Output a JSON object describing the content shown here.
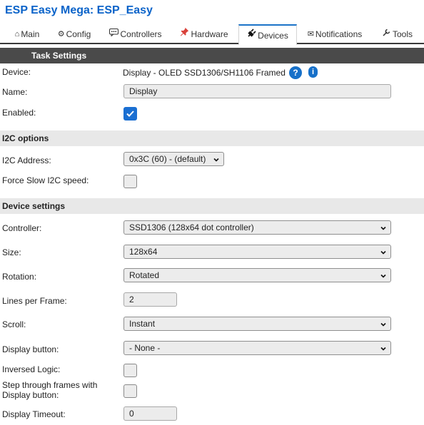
{
  "app": {
    "title": "ESP Easy Mega: ESP_Easy"
  },
  "tabs": [
    {
      "label": "Main",
      "icon": "home-icon",
      "glyph": "⌂"
    },
    {
      "label": "Config",
      "icon": "gear-icon",
      "glyph": "⚙"
    },
    {
      "label": "Controllers",
      "icon": "chat-icon",
      "glyph": "💬"
    },
    {
      "label": "Hardware",
      "icon": "pin-icon",
      "glyph": "📌"
    },
    {
      "label": "Devices",
      "icon": "plug-icon",
      "glyph": "✎",
      "active": true
    },
    {
      "label": "Notifications",
      "icon": "mail-icon",
      "glyph": "✉"
    },
    {
      "label": "Tools",
      "icon": "wrench-icon",
      "glyph": "🔧"
    }
  ],
  "header": {
    "title": "Task Settings"
  },
  "device": {
    "label": "Device:",
    "value": "Display - OLED SSD1306/SH1106 Framed",
    "help_glyph": "?",
    "info_glyph": "i"
  },
  "name": {
    "label": "Name:",
    "value": "Display"
  },
  "enabled": {
    "label": "Enabled:",
    "checked": true
  },
  "i2c_section": {
    "title": "I2C options"
  },
  "i2c_address": {
    "label": "I2C Address:",
    "value": "0x3C (60) - (default)"
  },
  "slow_i2c": {
    "label": "Force Slow I2C speed:",
    "checked": false
  },
  "device_section": {
    "title": "Device settings"
  },
  "controller": {
    "label": "Controller:",
    "value": "SSD1306 (128x64 dot controller)"
  },
  "size": {
    "label": "Size:",
    "value": "128x64"
  },
  "rotation": {
    "label": "Rotation:",
    "value": "Rotated"
  },
  "lines_per_frame": {
    "label": "Lines per Frame:",
    "value": "2"
  },
  "scroll": {
    "label": "Scroll:",
    "value": "Instant"
  },
  "display_button": {
    "label": "Display button:",
    "value": "- None -"
  },
  "inversed_logic": {
    "label": "Inversed Logic:",
    "checked": false
  },
  "step_frames": {
    "label_line1": "Step through frames with",
    "label_line2": "Display button:",
    "checked": false
  },
  "display_timeout": {
    "label": "Display Timeout:",
    "value": "0"
  },
  "colors": {
    "accent": "#1670c9",
    "title": "#0a63c9",
    "header_bg": "#4a4a4a",
    "section_bg": "#e8e8e8"
  }
}
